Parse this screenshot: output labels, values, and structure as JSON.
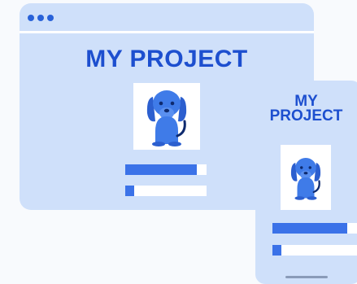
{
  "desktop": {
    "title": "MY PROJECT"
  },
  "phone": {
    "title_line1": "MY",
    "title_line2": "PROJECT"
  },
  "bars": [
    {
      "fill": 0.88
    },
    {
      "fill": 0.11
    }
  ],
  "colors": {
    "panel": "#cfe0fa",
    "accent": "#1d4fcf",
    "bar": "#3b72e8",
    "dog": "#3f7be8"
  },
  "icons": [
    "window-dots-icon",
    "dog-icon"
  ]
}
